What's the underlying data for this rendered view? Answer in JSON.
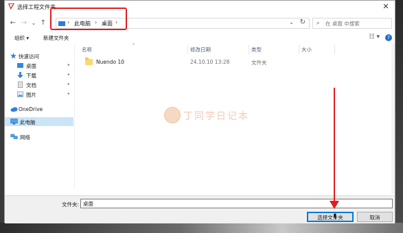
{
  "window": {
    "title": "选择工程文件夹",
    "close_glyph": "✕"
  },
  "nav": {
    "back": "←",
    "forward": "→",
    "recent": "⌄",
    "up": "↑"
  },
  "address": {
    "items": [
      "此电脑",
      "桌面"
    ],
    "separators": [
      "›",
      "›",
      "›"
    ],
    "dropdown": "⌄",
    "refresh": "↻"
  },
  "search": {
    "placeholder": "在 桌面 中搜索",
    "icon": "⌕"
  },
  "toolbar": {
    "organize": "组织 ▾",
    "new_folder": "新建文件夹",
    "view": "☷ ▾",
    "help": "?"
  },
  "sidebar": {
    "items": [
      {
        "label": "快速访问"
      },
      {
        "label": "桌面"
      },
      {
        "label": "下载"
      },
      {
        "label": "文档"
      },
      {
        "label": "图片"
      },
      {
        "label": "OneDrive"
      },
      {
        "label": "此电脑"
      },
      {
        "label": "网络"
      }
    ],
    "pin_glyph": "📌"
  },
  "list": {
    "columns": [
      "名称",
      "修改日期",
      "类型",
      "大小"
    ],
    "sort_glyph": "^",
    "rows": [
      {
        "name": "Nuendo 10",
        "modified": "24.10.10 13:28",
        "type": "文件夹",
        "size": ""
      }
    ]
  },
  "watermark": {
    "text": "丁同学日记本"
  },
  "footer": {
    "folder_label": "文件夹:",
    "folder_value": "桌面",
    "select_button": "选择文件夹",
    "cancel_button": "取消"
  },
  "colors": {
    "accent": "#0078d7",
    "annotation_red": "#e21c1c",
    "selected_bg": "#cce4f7"
  }
}
